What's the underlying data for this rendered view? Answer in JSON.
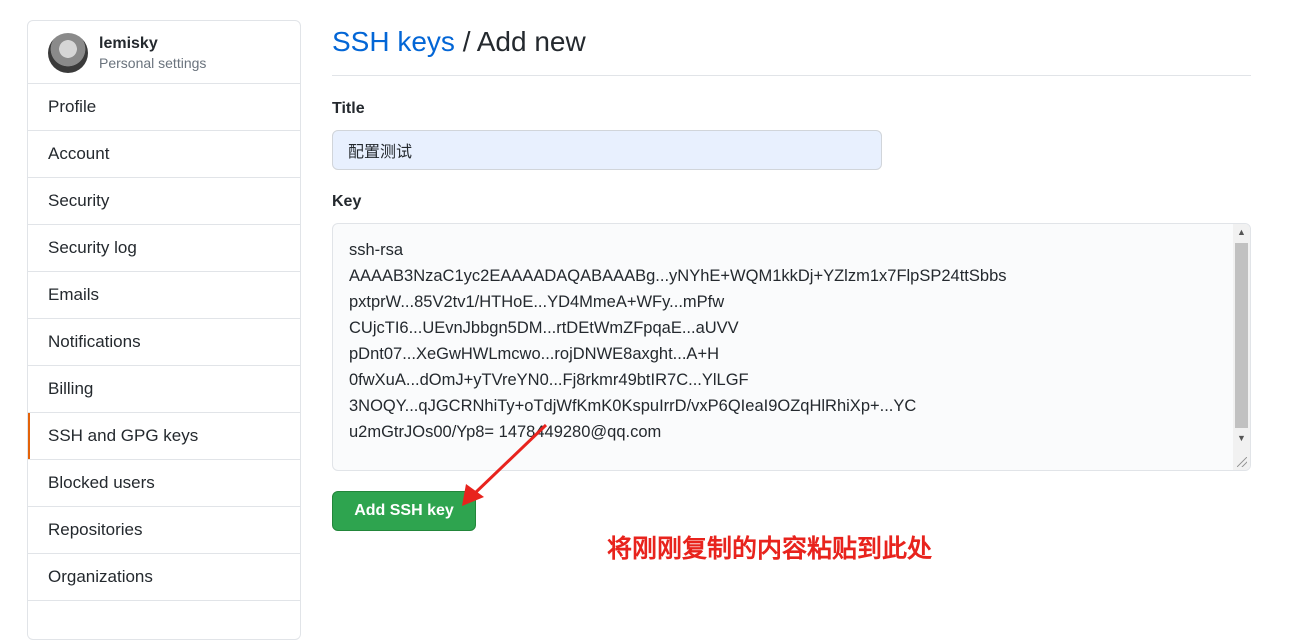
{
  "sidebar": {
    "username": "lemisky",
    "subtitle": "Personal settings",
    "items": [
      {
        "label": "Profile"
      },
      {
        "label": "Account"
      },
      {
        "label": "Security"
      },
      {
        "label": "Security log"
      },
      {
        "label": "Emails"
      },
      {
        "label": "Notifications"
      },
      {
        "label": "Billing"
      },
      {
        "label": "SSH and GPG keys",
        "selected": true
      },
      {
        "label": "Blocked users"
      },
      {
        "label": "Repositories"
      },
      {
        "label": "Organizations"
      }
    ]
  },
  "header": {
    "breadcrumb": "SSH keys",
    "separator": " / ",
    "current": "Add new"
  },
  "form": {
    "title_label": "Title",
    "title_value": "配置测试",
    "key_label": "Key",
    "key_value": "ssh-rsa\nAAAAB3NzaC1yc2EAAAADAQABAAABg...yNYhE+WQM1kkDj+YZlzm1x7FlpSP24ttSbbs\npxtprW...85V2tv1/HTHoE...YD4MmeA+WFy...mPfw\nCUjcTI6...UEvnJbbgn5DM...rtDEtWmZFpqaE...aUVV\npDnt07...XeGwHWLmcwo...rojDNWE8axght...A+H\n0fwXuA...dOmJ+yTVreYN0...Fj8rkmr49btIR7C...YlLGF\n3NOQY...qJGCRNhiTy+oTdjWfKmK0KspuIrrD/vxP6QIeaI9OZqHlRhiXp+...YC\nu2mGtrJOs00/Yp8= 1478449280@qq.com",
    "submit_label": "Add SSH key"
  },
  "annotation": {
    "text": "将刚刚复制的内容粘贴到此处",
    "color": "#e8231d"
  },
  "colors": {
    "link": "#0366d6",
    "button": "#2ea44f",
    "selected_marker": "#e36209"
  }
}
